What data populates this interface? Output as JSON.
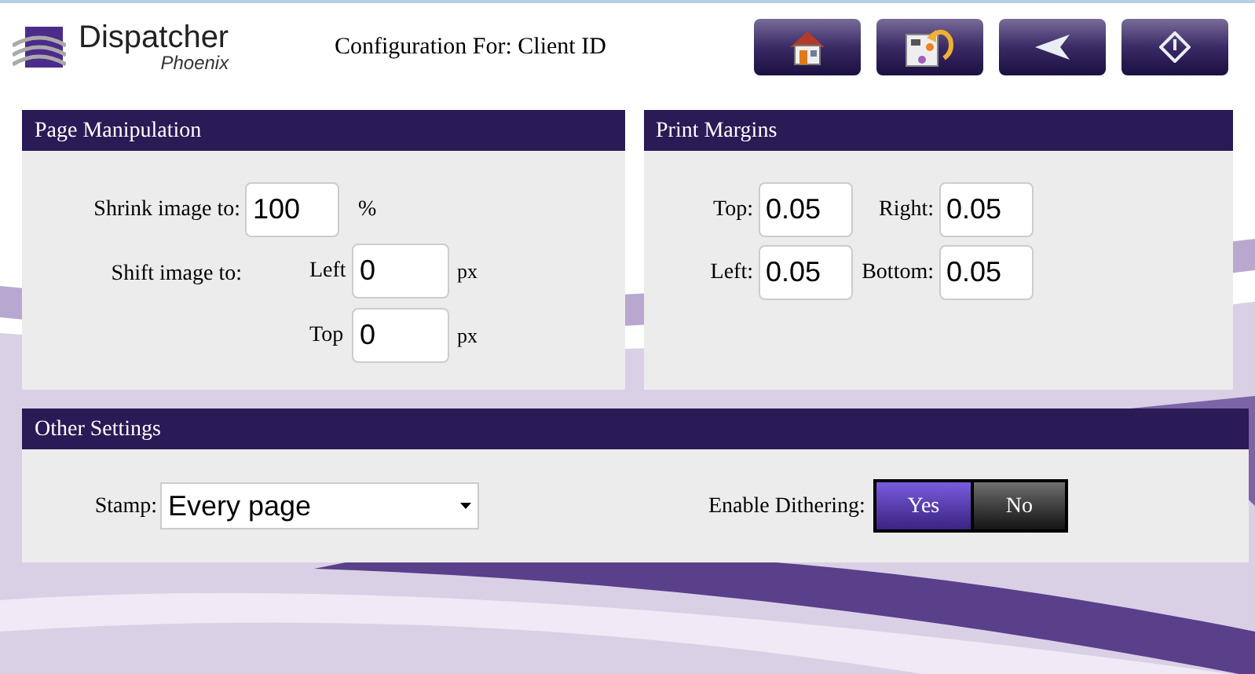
{
  "header": {
    "logo": {
      "name": "Dispatcher",
      "sub": "Phoenix"
    },
    "title": "Configuration For: Client ID"
  },
  "toolbar": [
    {
      "kind": "home"
    },
    {
      "kind": "undo"
    },
    {
      "kind": "back"
    },
    {
      "kind": "next"
    }
  ],
  "page_manipulation": {
    "title": "Page Manipulation",
    "shrink_label": "Shrink image to:",
    "shrink_value": "100",
    "shrink_unit": "%",
    "shift_label": "Shift image to:",
    "shift": [
      {
        "label": "Left",
        "value": "0",
        "unit": "px"
      },
      {
        "label": "Top",
        "value": "0",
        "unit": "px"
      }
    ]
  },
  "print_margins": {
    "title": "Print Margins",
    "fields": [
      {
        "label": "Top:",
        "value": "0.05"
      },
      {
        "label": "Right:",
        "value": "0.05"
      },
      {
        "label": "Left:",
        "value": "0.05"
      },
      {
        "label": "Bottom:",
        "value": "0.05"
      }
    ]
  },
  "other_settings": {
    "title": "Other Settings",
    "stamp_label": "Stamp:",
    "stamp_value": "Every page",
    "dithering_label": "Enable Dithering:",
    "dithering": [
      {
        "label": "Yes",
        "selected": true
      },
      {
        "label": "No",
        "selected": false
      }
    ]
  }
}
